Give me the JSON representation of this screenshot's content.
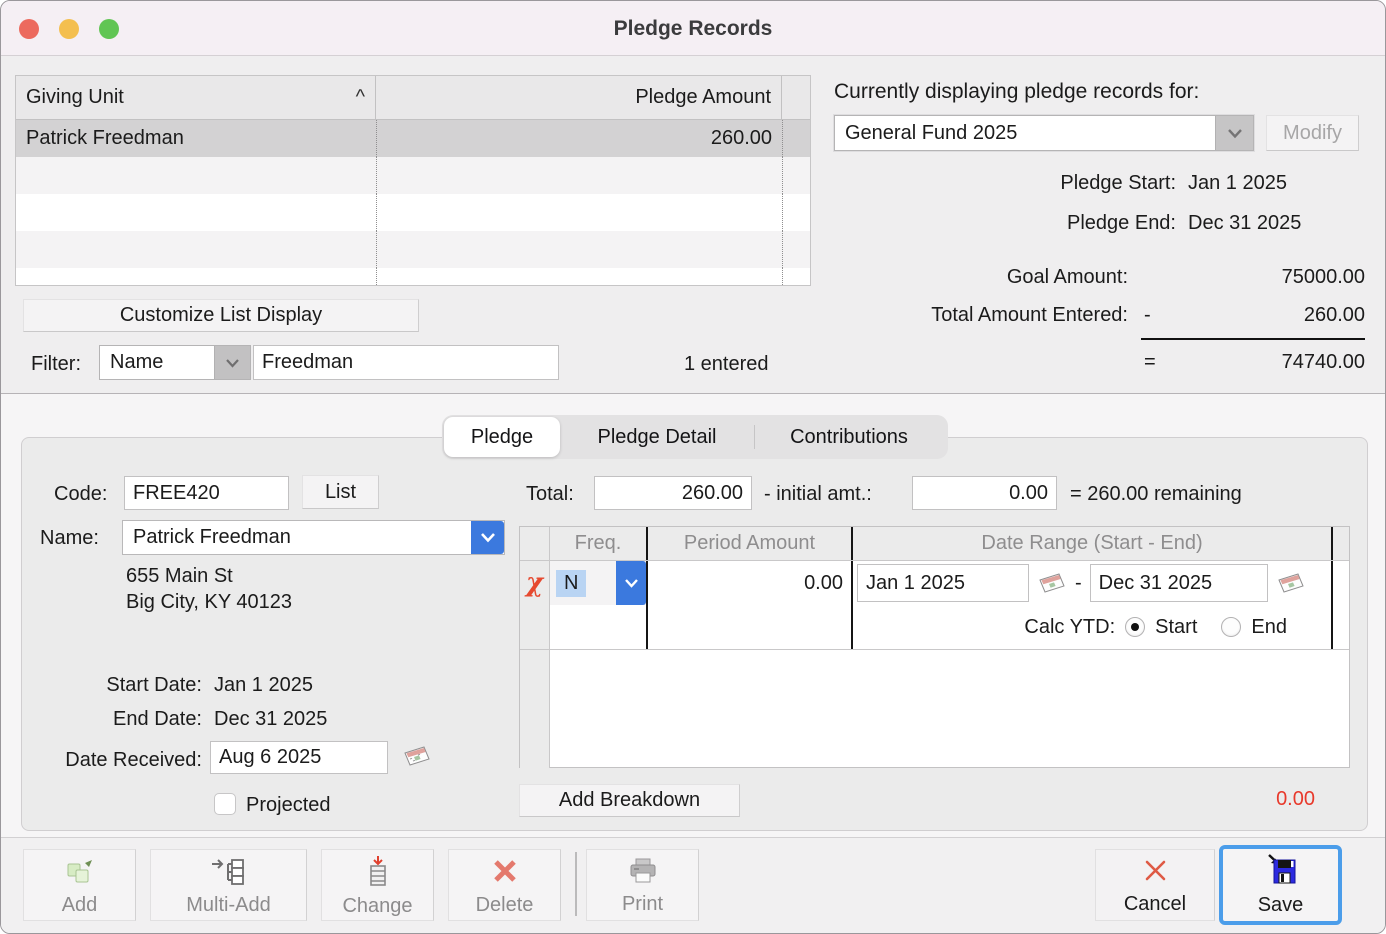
{
  "window": {
    "title": "Pledge Records"
  },
  "icons": {
    "sort_ascending": "^",
    "delete_row_chi": "χ"
  },
  "colors": {
    "accent_blue": "#3b79de",
    "save_focus_ring": "#4b9dea",
    "alert_red": "#e8392b",
    "chi_red": "#e6492f",
    "traffic_red": "#ec6a5e",
    "traffic_yellow": "#f4bf4f",
    "traffic_green": "#61c554"
  },
  "giving_list": {
    "columns": {
      "unit": "Giving Unit",
      "amount": "Pledge Amount"
    },
    "rows": [
      {
        "name": "Patrick Freedman",
        "amount": "260.00"
      }
    ],
    "customize_button": "Customize List Display",
    "filter": {
      "label": "Filter:",
      "field": "Name",
      "value": "Freedman"
    },
    "entered_count": "1 entered"
  },
  "fund_panel": {
    "heading": "Currently displaying pledge records for:",
    "fund_name": "General Fund 2025",
    "modify_button": "Modify",
    "pledge_start_label": "Pledge Start:",
    "pledge_start_value": "Jan 1 2025",
    "pledge_end_label": "Pledge End:",
    "pledge_end_value": "Dec 31 2025",
    "goal_label": "Goal Amount:",
    "goal_value": "75000.00",
    "total_entered_label": "Total Amount Entered:",
    "minus_sign": "-",
    "total_entered_value": "260.00",
    "equals_sign": "=",
    "remaining_value": "74740.00"
  },
  "tabs": {
    "items": [
      {
        "label": "Pledge"
      },
      {
        "label": "Pledge Detail"
      },
      {
        "label": "Contributions"
      }
    ],
    "selected": "Pledge"
  },
  "pledge_form": {
    "code_label": "Code:",
    "code_value": "FREE420",
    "list_button": "List",
    "name_label": "Name:",
    "name_value": "Patrick Freedman",
    "address_line1": "655 Main St",
    "address_line2": "Big City, KY 40123",
    "start_date_label": "Start Date:",
    "start_date_value": "Jan 1 2025",
    "end_date_label": "End Date:",
    "end_date_value": "Dec 31 2025",
    "date_received_label": "Date Received:",
    "date_received_value": "Aug 6 2025",
    "projected_label": "Projected",
    "projected_checked": false,
    "total_label": "Total:",
    "total_value": "260.00",
    "initial_label": "- initial amt.:",
    "initial_value": "0.00",
    "remaining_text": "= 260.00 remaining"
  },
  "breakdown": {
    "columns": {
      "freq": "Freq.",
      "period_amount": "Period Amount",
      "date_range": "Date Range (Start - End)"
    },
    "row": {
      "freq": "N",
      "period_amount": "0.00",
      "date_start": "Jan 1 2025",
      "dash": "-",
      "date_end": "Dec 31 2025"
    },
    "calc_ytd": {
      "label": "Calc YTD:",
      "start": "Start",
      "end": "End",
      "selected": "Start"
    },
    "add_button": "Add Breakdown",
    "unallocated": "0.00"
  },
  "toolbar": {
    "add": "Add",
    "multi_add": "Multi-Add",
    "change": "Change",
    "delete": "Delete",
    "print": "Print",
    "cancel": "Cancel",
    "save": "Save"
  }
}
